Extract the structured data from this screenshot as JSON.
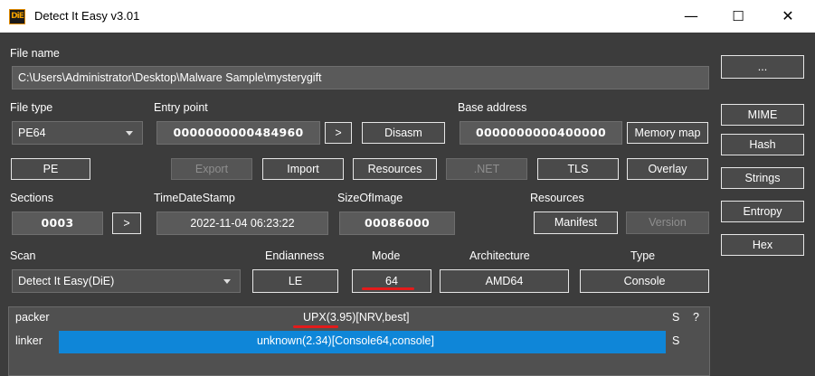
{
  "window": {
    "icon_text": "DiE",
    "title": "Detect It Easy v3.01",
    "minimize": "—",
    "maximize": "☐",
    "close": "✕"
  },
  "file": {
    "label": "File name",
    "path": "C:\\Users\\Administrator\\Desktop\\Malware Sample\\mysterygift",
    "browse": "..."
  },
  "file_type": {
    "label": "File type",
    "value": "PE64"
  },
  "entry_point": {
    "label": "Entry point",
    "value": "0000000000484960",
    "go": ">",
    "disasm": "Disasm"
  },
  "base_address": {
    "label": "Base address",
    "value": "0000000000400000",
    "memory_map": "Memory map"
  },
  "side_buttons": {
    "mime": "MIME",
    "hash": "Hash",
    "strings": "Strings",
    "entropy": "Entropy",
    "hex": "Hex"
  },
  "section_buttons": {
    "pe": "PE",
    "export": "Export",
    "import": "Import",
    "resources": "Resources",
    "net": ".NET",
    "tls": "TLS",
    "overlay": "Overlay"
  },
  "sections": {
    "label": "Sections",
    "value": "0003",
    "go": ">"
  },
  "timedatestamp": {
    "label": "TimeDateStamp",
    "value": "2022-11-04 06:23:22"
  },
  "sizeofimage": {
    "label": "SizeOfImage",
    "value": "00086000"
  },
  "resources": {
    "label": "Resources",
    "manifest": "Manifest",
    "version": "Version"
  },
  "scan": {
    "label": "Scan",
    "engine": "Detect It Easy(DiE)",
    "endianness_label": "Endianness",
    "endianness": "LE",
    "mode_label": "Mode",
    "mode": "64",
    "architecture_label": "Architecture",
    "architecture": "AMD64",
    "type_label": "Type",
    "type": "Console"
  },
  "results": [
    {
      "kind": "packer",
      "text": "UPX(3.95)[NRV,best]",
      "flags": "S",
      "help": "?"
    },
    {
      "kind": "linker",
      "text": "unknown(2.34)[Console64,console]",
      "flags": "S"
    }
  ],
  "colors": {
    "background": "#3c3c3c",
    "field": "#5a5a5a",
    "highlight": "#0f86d8",
    "annotation_underline": "#e31b1b"
  }
}
